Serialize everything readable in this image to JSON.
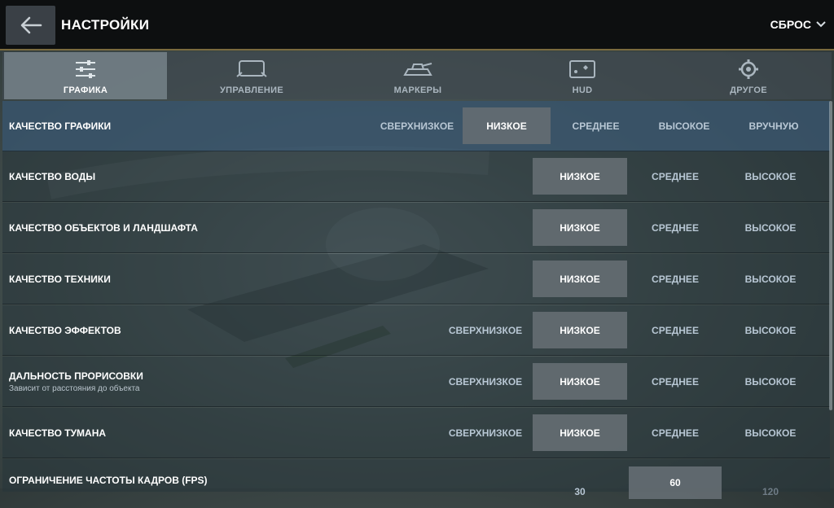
{
  "header": {
    "title": "НАСТРОЙКИ",
    "reset_label": "СБРОС"
  },
  "tabs": [
    {
      "label": "ГРАФИКА",
      "icon": "sliders-icon",
      "active": true
    },
    {
      "label": "УПРАВЛЕНИЕ",
      "icon": "device-icon",
      "active": false
    },
    {
      "label": "МАРКЕРЫ",
      "icon": "tank-icon",
      "active": false
    },
    {
      "label": "HUD",
      "icon": "screen-icon",
      "active": false
    },
    {
      "label": "ДРУГОЕ",
      "icon": "gear-icon",
      "active": false
    }
  ],
  "settings": {
    "graphics_quality": {
      "label": "КАЧЕСТВО ГРАФИКИ",
      "options": [
        "СВЕРХНИЗКОЕ",
        "НИЗКОЕ",
        "СРЕДНЕЕ",
        "ВЫСОКОЕ",
        "ВРУЧНУЮ"
      ],
      "selected": "НИЗКОЕ"
    },
    "water_quality": {
      "label": "КАЧЕСТВО ВОДЫ",
      "options": [
        "НИЗКОЕ",
        "СРЕДНЕЕ",
        "ВЫСОКОЕ"
      ],
      "selected": "НИЗКОЕ"
    },
    "objects_quality": {
      "label": "КАЧЕСТВО ОБЪЕКТОВ И ЛАНДШАФТА",
      "options": [
        "НИЗКОЕ",
        "СРЕДНЕЕ",
        "ВЫСОКОЕ"
      ],
      "selected": "НИЗКОЕ"
    },
    "vehicle_quality": {
      "label": "КАЧЕСТВО ТЕХНИКИ",
      "options": [
        "НИЗКОЕ",
        "СРЕДНЕЕ",
        "ВЫСОКОЕ"
      ],
      "selected": "НИЗКОЕ"
    },
    "effects_quality": {
      "label": "КАЧЕСТВО ЭФФЕКТОВ",
      "options": [
        "СВЕРХНИЗКОЕ",
        "НИЗКОЕ",
        "СРЕДНЕЕ",
        "ВЫСОКОЕ"
      ],
      "selected": "НИЗКОЕ"
    },
    "draw_distance": {
      "label": "ДАЛЬНОСТЬ ПРОРИСОВКИ",
      "sublabel": "Зависит от расстояния до объекта",
      "options": [
        "СВЕРХНИЗКОЕ",
        "НИЗКОЕ",
        "СРЕДНЕЕ",
        "ВЫСОКОЕ"
      ],
      "selected": "НИЗКОЕ"
    },
    "fog_quality": {
      "label": "КАЧЕСТВО ТУМАНА",
      "options": [
        "СВЕРХНИЗКОЕ",
        "НИЗКОЕ",
        "СРЕДНЕЕ",
        "ВЫСОКОЕ"
      ],
      "selected": "НИЗКОЕ"
    },
    "fps_limit": {
      "label": "ОГРАНИЧЕНИЕ ЧАСТОТЫ КАДРОВ (FPS)",
      "options": [
        "30",
        "60",
        "120"
      ],
      "selected": "60"
    }
  }
}
